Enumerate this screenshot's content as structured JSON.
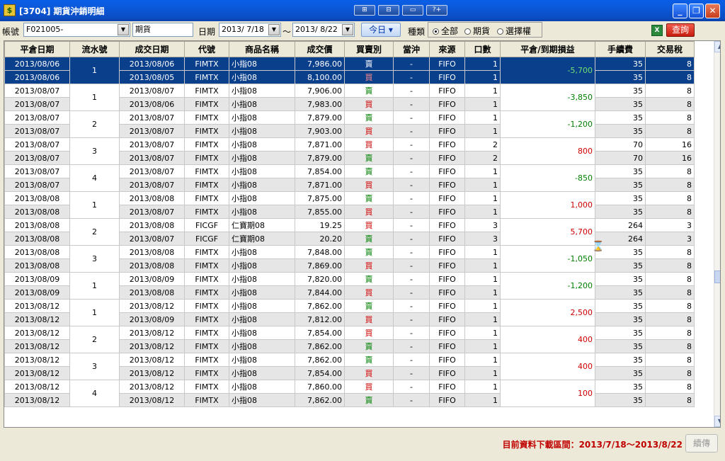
{
  "window": {
    "title": "[3704] 期貨沖銷明細",
    "title_icon": "app-icon"
  },
  "title_buttons": [
    "⊞",
    "⊟",
    "▭",
    "?+"
  ],
  "win_controls": {
    "minimize": "_",
    "restore": "❐",
    "close": "✕"
  },
  "toolbar": {
    "account_label": "帳號",
    "account_value": "F021005-",
    "type_field_value": "期貨",
    "date_label": "日期",
    "date_from": "2013/ 7/18",
    "date_sep": "～",
    "date_to": "2013/ 8/22",
    "today_button": "今日 ▾",
    "category_label": "種類",
    "radio_options": [
      {
        "label": "全部",
        "checked": true
      },
      {
        "label": "期貨",
        "checked": false
      },
      {
        "label": "選擇權",
        "checked": false
      }
    ],
    "excel_icon": "X",
    "query_button": "查詢"
  },
  "table": {
    "columns": [
      "平倉日期",
      "流水號",
      "成交日期",
      "代號",
      "商品名稱",
      "成交價",
      "買賣別",
      "當沖",
      "來源",
      "口數",
      "平倉/到期損益",
      "手續費",
      "交易稅"
    ],
    "groups": [
      {
        "serial": "1",
        "pl": "-5,700",
        "sel": true,
        "rows": [
          {
            "close": "2013/08/06",
            "trade": "2013/08/06",
            "code": "FIMTX",
            "name": "小指08",
            "price": "7,986.00",
            "bs": "賣",
            "dt": "-",
            "src": "FIFO",
            "qty": "1",
            "fee": "35",
            "tax": "8"
          },
          {
            "close": "2013/08/06",
            "trade": "2013/08/05",
            "code": "FIMTX",
            "name": "小指08",
            "price": "8,100.00",
            "bs": "買",
            "dt": "-",
            "src": "FIFO",
            "qty": "1",
            "fee": "35",
            "tax": "8"
          }
        ]
      },
      {
        "serial": "1",
        "pl": "-3,850",
        "rows": [
          {
            "close": "2013/08/07",
            "trade": "2013/08/07",
            "code": "FIMTX",
            "name": "小指08",
            "price": "7,906.00",
            "bs": "賣",
            "dt": "-",
            "src": "FIFO",
            "qty": "1",
            "fee": "35",
            "tax": "8"
          },
          {
            "close": "2013/08/07",
            "trade": "2013/08/06",
            "code": "FIMTX",
            "name": "小指08",
            "price": "7,983.00",
            "bs": "買",
            "dt": "-",
            "src": "FIFO",
            "qty": "1",
            "fee": "35",
            "tax": "8"
          }
        ]
      },
      {
        "serial": "2",
        "pl": "-1,200",
        "rows": [
          {
            "close": "2013/08/07",
            "trade": "2013/08/07",
            "code": "FIMTX",
            "name": "小指08",
            "price": "7,879.00",
            "bs": "賣",
            "dt": "-",
            "src": "FIFO",
            "qty": "1",
            "fee": "35",
            "tax": "8"
          },
          {
            "close": "2013/08/07",
            "trade": "2013/08/07",
            "code": "FIMTX",
            "name": "小指08",
            "price": "7,903.00",
            "bs": "買",
            "dt": "-",
            "src": "FIFO",
            "qty": "1",
            "fee": "35",
            "tax": "8"
          }
        ]
      },
      {
        "serial": "3",
        "pl": "800",
        "rows": [
          {
            "close": "2013/08/07",
            "trade": "2013/08/07",
            "code": "FIMTX",
            "name": "小指08",
            "price": "7,871.00",
            "bs": "買",
            "dt": "-",
            "src": "FIFO",
            "qty": "2",
            "fee": "70",
            "tax": "16"
          },
          {
            "close": "2013/08/07",
            "trade": "2013/08/07",
            "code": "FIMTX",
            "name": "小指08",
            "price": "7,879.00",
            "bs": "賣",
            "dt": "-",
            "src": "FIFO",
            "qty": "2",
            "fee": "70",
            "tax": "16"
          }
        ]
      },
      {
        "serial": "4",
        "pl": "-850",
        "rows": [
          {
            "close": "2013/08/07",
            "trade": "2013/08/07",
            "code": "FIMTX",
            "name": "小指08",
            "price": "7,854.00",
            "bs": "賣",
            "dt": "-",
            "src": "FIFO",
            "qty": "1",
            "fee": "35",
            "tax": "8"
          },
          {
            "close": "2013/08/07",
            "trade": "2013/08/07",
            "code": "FIMTX",
            "name": "小指08",
            "price": "7,871.00",
            "bs": "買",
            "dt": "-",
            "src": "FIFO",
            "qty": "1",
            "fee": "35",
            "tax": "8"
          }
        ]
      },
      {
        "serial": "1",
        "pl": "1,000",
        "rows": [
          {
            "close": "2013/08/08",
            "trade": "2013/08/08",
            "code": "FIMTX",
            "name": "小指08",
            "price": "7,875.00",
            "bs": "賣",
            "dt": "-",
            "src": "FIFO",
            "qty": "1",
            "fee": "35",
            "tax": "8"
          },
          {
            "close": "2013/08/08",
            "trade": "2013/08/07",
            "code": "FIMTX",
            "name": "小指08",
            "price": "7,855.00",
            "bs": "買",
            "dt": "-",
            "src": "FIFO",
            "qty": "1",
            "fee": "35",
            "tax": "8"
          }
        ]
      },
      {
        "serial": "2",
        "pl": "5,700",
        "rows": [
          {
            "close": "2013/08/08",
            "trade": "2013/08/08",
            "code": "FICGF",
            "name": "仁寶期08",
            "price": "19.25",
            "bs": "買",
            "dt": "-",
            "src": "FIFO",
            "qty": "3",
            "fee": "264",
            "tax": "3"
          },
          {
            "close": "2013/08/08",
            "trade": "2013/08/07",
            "code": "FICGF",
            "name": "仁寶期08",
            "price": "20.20",
            "bs": "賣",
            "dt": "-",
            "src": "FIFO",
            "qty": "3",
            "fee": "264",
            "tax": "3"
          }
        ]
      },
      {
        "serial": "3",
        "pl": "-1,050",
        "rows": [
          {
            "close": "2013/08/08",
            "trade": "2013/08/08",
            "code": "FIMTX",
            "name": "小指08",
            "price": "7,848.00",
            "bs": "賣",
            "dt": "-",
            "src": "FIFO",
            "qty": "1",
            "fee": "35",
            "tax": "8"
          },
          {
            "close": "2013/08/08",
            "trade": "2013/08/08",
            "code": "FIMTX",
            "name": "小指08",
            "price": "7,869.00",
            "bs": "買",
            "dt": "-",
            "src": "FIFO",
            "qty": "1",
            "fee": "35",
            "tax": "8"
          }
        ]
      },
      {
        "serial": "1",
        "pl": "-1,200",
        "rows": [
          {
            "close": "2013/08/09",
            "trade": "2013/08/09",
            "code": "FIMTX",
            "name": "小指08",
            "price": "7,820.00",
            "bs": "賣",
            "dt": "-",
            "src": "FIFO",
            "qty": "1",
            "fee": "35",
            "tax": "8"
          },
          {
            "close": "2013/08/09",
            "trade": "2013/08/08",
            "code": "FIMTX",
            "name": "小指08",
            "price": "7,844.00",
            "bs": "買",
            "dt": "-",
            "src": "FIFO",
            "qty": "1",
            "fee": "35",
            "tax": "8"
          }
        ]
      },
      {
        "serial": "1",
        "pl": "2,500",
        "rows": [
          {
            "close": "2013/08/12",
            "trade": "2013/08/12",
            "code": "FIMTX",
            "name": "小指08",
            "price": "7,862.00",
            "bs": "賣",
            "dt": "-",
            "src": "FIFO",
            "qty": "1",
            "fee": "35",
            "tax": "8"
          },
          {
            "close": "2013/08/12",
            "trade": "2013/08/09",
            "code": "FIMTX",
            "name": "小指08",
            "price": "7,812.00",
            "bs": "買",
            "dt": "-",
            "src": "FIFO",
            "qty": "1",
            "fee": "35",
            "tax": "8"
          }
        ]
      },
      {
        "serial": "2",
        "pl": "400",
        "rows": [
          {
            "close": "2013/08/12",
            "trade": "2013/08/12",
            "code": "FIMTX",
            "name": "小指08",
            "price": "7,854.00",
            "bs": "買",
            "dt": "-",
            "src": "FIFO",
            "qty": "1",
            "fee": "35",
            "tax": "8"
          },
          {
            "close": "2013/08/12",
            "trade": "2013/08/12",
            "code": "FIMTX",
            "name": "小指08",
            "price": "7,862.00",
            "bs": "賣",
            "dt": "-",
            "src": "FIFO",
            "qty": "1",
            "fee": "35",
            "tax": "8"
          }
        ]
      },
      {
        "serial": "3",
        "pl": "400",
        "rows": [
          {
            "close": "2013/08/12",
            "trade": "2013/08/12",
            "code": "FIMTX",
            "name": "小指08",
            "price": "7,862.00",
            "bs": "賣",
            "dt": "-",
            "src": "FIFO",
            "qty": "1",
            "fee": "35",
            "tax": "8"
          },
          {
            "close": "2013/08/12",
            "trade": "2013/08/12",
            "code": "FIMTX",
            "name": "小指08",
            "price": "7,854.00",
            "bs": "買",
            "dt": "-",
            "src": "FIFO",
            "qty": "1",
            "fee": "35",
            "tax": "8"
          }
        ]
      },
      {
        "serial": "4",
        "pl": "100",
        "rows": [
          {
            "close": "2013/08/12",
            "trade": "2013/08/12",
            "code": "FIMTX",
            "name": "小指08",
            "price": "7,860.00",
            "bs": "買",
            "dt": "-",
            "src": "FIFO",
            "qty": "1",
            "fee": "35",
            "tax": "8"
          },
          {
            "close": "2013/08/12",
            "trade": "2013/08/12",
            "code": "FIMTX",
            "name": "小指08",
            "price": "7,862.00",
            "bs": "賣",
            "dt": "-",
            "src": "FIFO",
            "qty": "1",
            "fee": "35",
            "tax": "8"
          }
        ]
      }
    ]
  },
  "status": {
    "download_range": "目前資料下載區間：2013/7/18～2013/8/22",
    "continue_button": "續傳"
  },
  "colors": {
    "title_bar": "#0a5ee6",
    "selected_row": "#0a3f8c",
    "profit": "#d00000",
    "loss": "#008000",
    "status_text": "#c00000"
  },
  "icons": {
    "hourglass": "⌛",
    "scroll_up": "▲",
    "scroll_down": "▼"
  }
}
